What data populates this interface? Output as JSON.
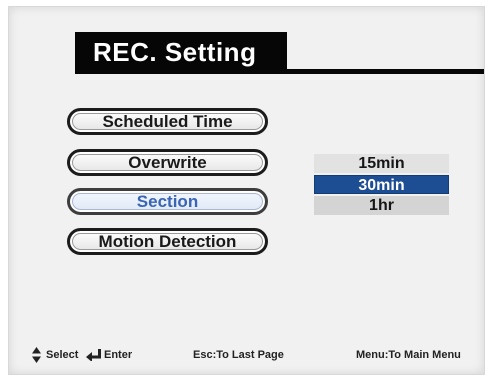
{
  "header": {
    "title": "REC. Setting"
  },
  "menu": {
    "items": [
      {
        "label": "Scheduled Time",
        "selected": false
      },
      {
        "label": "Overwrite",
        "selected": false
      },
      {
        "label": "Section",
        "selected": true
      },
      {
        "label": "Motion Detection",
        "selected": false
      }
    ]
  },
  "options": {
    "items": [
      {
        "label": "15min",
        "selected": false
      },
      {
        "label": "30min",
        "selected": true
      },
      {
        "label": "1hr",
        "selected": false
      }
    ]
  },
  "footer": {
    "select_icon": "up-down-arrow-icon",
    "select_label": "Select",
    "enter_icon": "enter-arrow-icon",
    "enter_label": "Enter",
    "esc_label": "Esc:To Last Page",
    "menu_label": "Menu:To Main Menu"
  },
  "colors": {
    "accent": "#1d4e93",
    "selected_text": "#3a64b4",
    "title_bg": "#060606"
  }
}
